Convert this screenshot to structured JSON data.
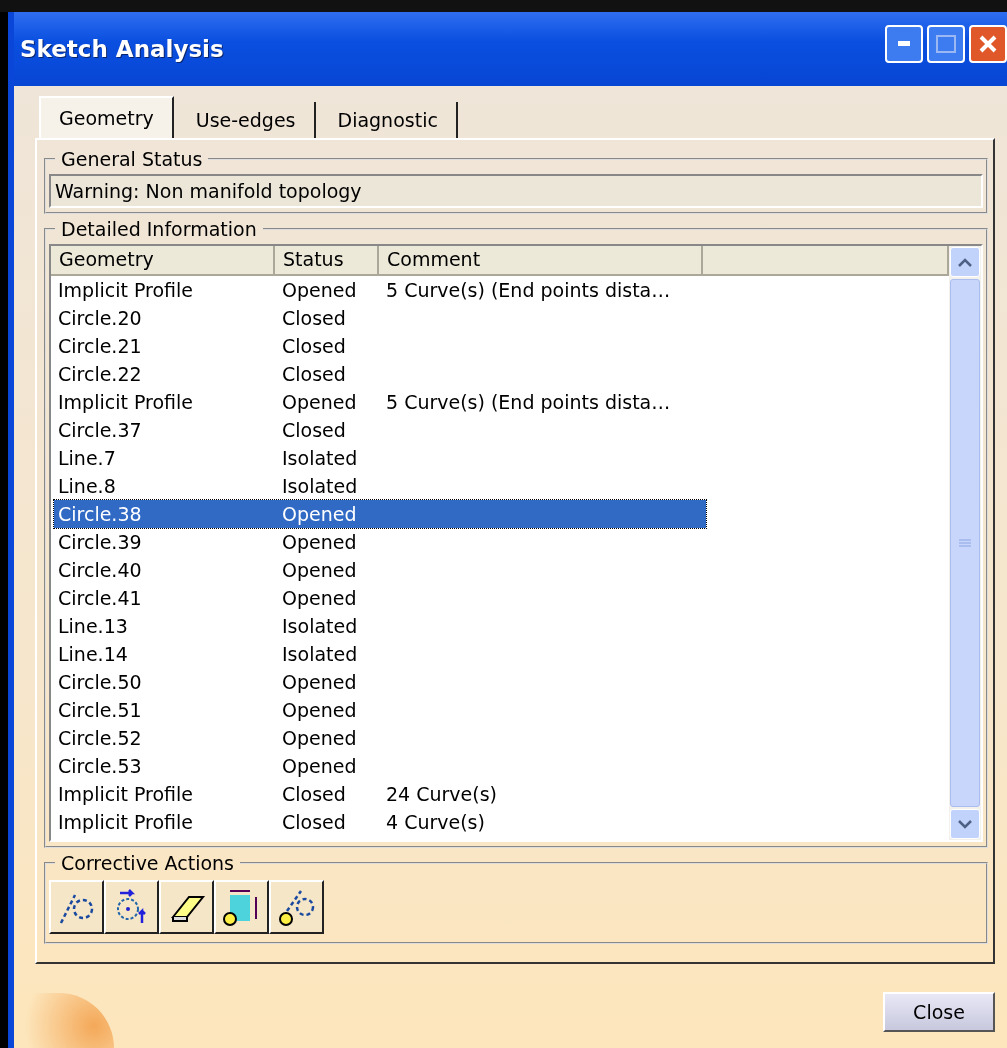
{
  "window": {
    "title": "Sketch Analysis"
  },
  "tabs": [
    {
      "label": "Geometry",
      "selected": true
    },
    {
      "label": "Use-edges",
      "selected": false
    },
    {
      "label": "Diagnostic",
      "selected": false
    }
  ],
  "general_status": {
    "title": "General Status",
    "message": "Warning: Non manifold topology"
  },
  "detailed_information": {
    "title": "Detailed Information",
    "columns": [
      "Geometry",
      "Status",
      "Comment"
    ],
    "rows": [
      {
        "geometry": "Implicit Profile",
        "status": "Opened",
        "comment": "5 Curve(s) (End points dista…",
        "selected": false
      },
      {
        "geometry": "Circle.20",
        "status": "Closed",
        "selected": false
      },
      {
        "geometry": "Circle.21",
        "status": "Closed",
        "selected": false
      },
      {
        "geometry": "Circle.22",
        "status": "Closed",
        "selected": false
      },
      {
        "geometry": "Implicit Profile",
        "status": "Opened",
        "comment": "5 Curve(s) (End points dista…",
        "selected": false
      },
      {
        "geometry": "Circle.37",
        "status": "Closed",
        "selected": false
      },
      {
        "geometry": "Line.7",
        "status": "Isolated",
        "selected": false
      },
      {
        "geometry": "Line.8",
        "status": "Isolated",
        "selected": false
      },
      {
        "geometry": "Circle.38",
        "status": "Opened",
        "selected": true
      },
      {
        "geometry": "Circle.39",
        "status": "Opened",
        "selected": false
      },
      {
        "geometry": "Circle.40",
        "status": "Opened",
        "selected": false
      },
      {
        "geometry": "Circle.41",
        "status": "Opened",
        "selected": false
      },
      {
        "geometry": "Line.13",
        "status": "Isolated",
        "selected": false
      },
      {
        "geometry": "Line.14",
        "status": "Isolated",
        "selected": false
      },
      {
        "geometry": "Circle.50",
        "status": "Opened",
        "selected": false
      },
      {
        "geometry": "Circle.51",
        "status": "Opened",
        "selected": false
      },
      {
        "geometry": "Circle.52",
        "status": "Opened",
        "selected": false
      },
      {
        "geometry": "Circle.53",
        "status": "Opened",
        "selected": false
      },
      {
        "geometry": "Implicit Profile",
        "status": "Closed",
        "comment": "24 Curve(s)",
        "selected": false
      },
      {
        "geometry": "Implicit Profile",
        "status": "Closed",
        "comment": "4 Curve(s)",
        "selected": false
      }
    ]
  },
  "corrective_actions": {
    "title": "Corrective Actions"
  },
  "close_button": "Close"
}
